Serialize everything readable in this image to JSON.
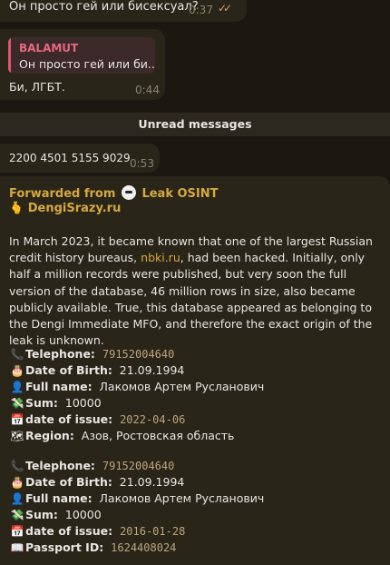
{
  "messages": {
    "m1": {
      "text": "Он просто гей или бисексуал?",
      "time": "0:37",
      "checks": "✓✓"
    },
    "m2": {
      "reply_author": "BALAMUT",
      "reply_quote": "Он просто гей или би...",
      "text": "Би, ЛГБТ.",
      "time": "0:44"
    },
    "unread_label": "Unread messages",
    "m3": {
      "text": "2200 4501 5155 9029",
      "time": "0:53"
    },
    "m4": {
      "forwarded_from": "Forwarded from",
      "channel": "Leak OSINT",
      "source_emoji": "🫰",
      "source_link": "DengiSrazy.ru",
      "body_before_link": "In March 2023, it became known that one of the largest Russian credit history bureaus, ",
      "body_link": "nbki.ru",
      "body_after_link": ", had been hacked. Initially, only half a million records were published, but very soon the full version of the database, 46 million rows in size, also became publicly available. True, this database appeared as belonging to the Dengi Immediate MFO, and therefore the exact origin of the leak is unknown.",
      "records": [
        [
          {
            "icon": "📞",
            "icon_name": "telephone-icon",
            "label": "Telephone:",
            "value": "79152004640",
            "mono": true
          },
          {
            "icon": "🎂",
            "icon_name": "birthday-cake-icon",
            "label": "Date of Birth:",
            "value": "21.09.1994",
            "mono": false
          },
          {
            "icon": "👤",
            "icon_name": "person-icon",
            "label": "Full name:",
            "value": "Лакомов Артем Русланович",
            "mono": false
          },
          {
            "icon": "💸",
            "icon_name": "money-icon",
            "label": "Sum:",
            "value": "10000",
            "mono": false
          },
          {
            "icon": "📅",
            "icon_name": "calendar-icon",
            "label": "date of issue:",
            "value": "2022-04-06",
            "mono": true
          },
          {
            "icon": "🗺",
            "icon_name": "map-icon",
            "label": "Region:",
            "value": "Азов, Ростовская область",
            "mono": false
          }
        ],
        [
          {
            "icon": "📞",
            "icon_name": "telephone-icon",
            "label": "Telephone:",
            "value": "79152004640",
            "mono": true
          },
          {
            "icon": "🎂",
            "icon_name": "birthday-cake-icon",
            "label": "Date of Birth:",
            "value": "21.09.1994",
            "mono": false
          },
          {
            "icon": "👤",
            "icon_name": "person-icon",
            "label": "Full name:",
            "value": "Лакомов Артем Русланович",
            "mono": false
          },
          {
            "icon": "💸",
            "icon_name": "money-icon",
            "label": "Sum:",
            "value": "10000",
            "mono": false
          },
          {
            "icon": "📅",
            "icon_name": "calendar-icon",
            "label": "date of issue:",
            "value": "2016-01-28",
            "mono": true
          },
          {
            "icon": "📖",
            "icon_name": "passport-icon",
            "label": "Passport ID:",
            "value": "1624408024",
            "mono": true
          }
        ]
      ]
    }
  },
  "colors": {
    "background": "#1c1811",
    "bubble": "#2a2519",
    "accent_gold": "#d4a93f",
    "reply_accent": "#e0566f"
  }
}
